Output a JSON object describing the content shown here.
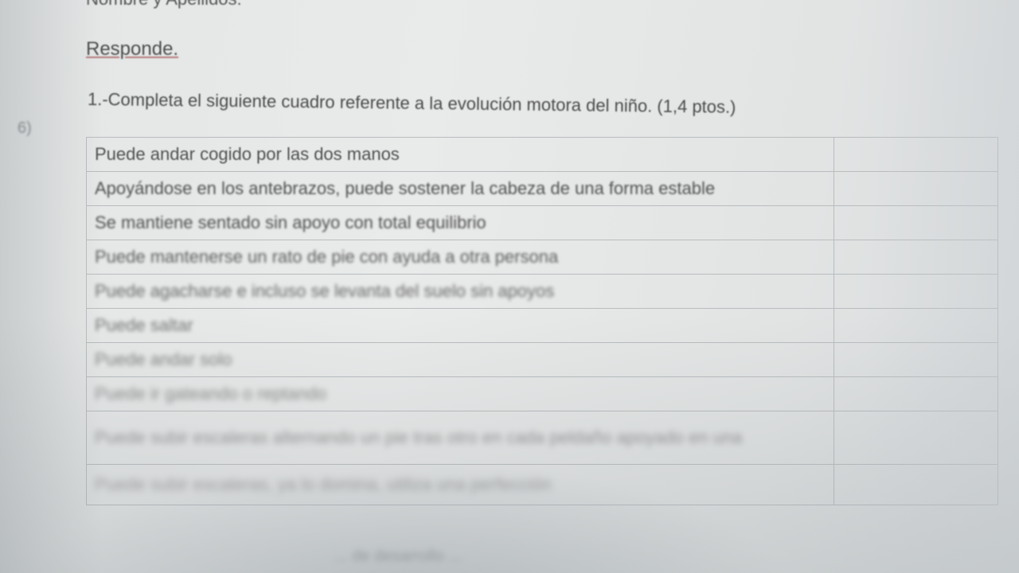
{
  "header": {
    "name_line": "Nombre y Apellidos:"
  },
  "section_title": "Responde.",
  "question": "1.-Completa el siguiente cuadro referente a la evolución motora del niño. (1,4 ptos.)",
  "margin_mark": "6)",
  "table": {
    "rows": [
      {
        "text": "Puede andar cogido por las dos manos",
        "age": ""
      },
      {
        "text": "Apoyándose en los antebrazos, puede sostener la cabeza de una forma estable",
        "age": ""
      },
      {
        "text": "Se mantiene sentado sin apoyo con total equilibrio",
        "age": ""
      },
      {
        "text": "Puede mantenerse un rato de pie con ayuda a otra persona",
        "age": ""
      },
      {
        "text": "Puede agacharse e incluso se levanta del suelo sin apoyos",
        "age": ""
      },
      {
        "text": "Puede saltar",
        "age": ""
      },
      {
        "text": "Puede andar solo",
        "age": ""
      },
      {
        "text": "Puede ir gateando o reptando",
        "age": ""
      },
      {
        "text": "Puede subir escaleras alternando un pie tras otro en cada peldaño apoyado en una",
        "age": ""
      },
      {
        "text": "Puede subir escaleras, ya lo domina, utiliza una perfección",
        "age": ""
      }
    ]
  },
  "footer": "... de desarrollo ..."
}
